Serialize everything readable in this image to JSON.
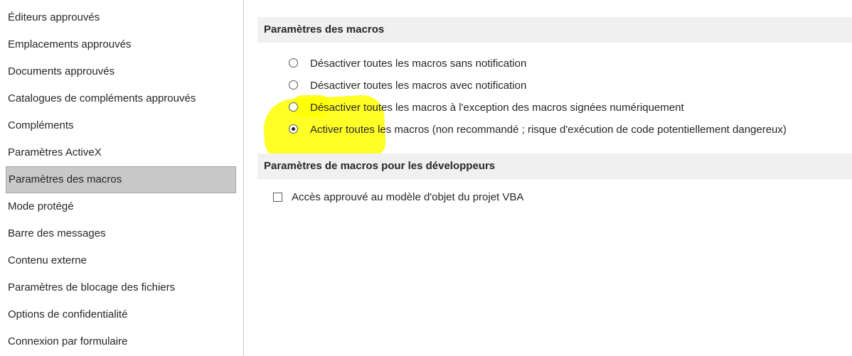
{
  "sidebar": {
    "items": [
      {
        "label": "Éditeurs approuvés"
      },
      {
        "label": "Emplacements approuvés"
      },
      {
        "label": "Documents approuvés"
      },
      {
        "label": "Catalogues de compléments approuvés"
      },
      {
        "label": "Compléments"
      },
      {
        "label": "Paramètres ActiveX"
      },
      {
        "label": "Paramètres des macros",
        "selected": true
      },
      {
        "label": "Mode protégé"
      },
      {
        "label": "Barre des messages"
      },
      {
        "label": "Contenu externe"
      },
      {
        "label": "Paramètres de blocage des fichiers"
      },
      {
        "label": "Options de confidentialité"
      },
      {
        "label": "Connexion par formulaire"
      }
    ]
  },
  "macro_settings": {
    "header": "Paramètres des macros",
    "options": [
      {
        "label": "Désactiver toutes les macros sans notification",
        "checked": false
      },
      {
        "label": "Désactiver toutes les macros avec notification",
        "checked": false
      },
      {
        "label": "Désactiver toutes les macros à l'exception des macros signées numériquement",
        "checked": false
      },
      {
        "label": "Activer toutes les macros (non recommandé ; risque d'exécution de code potentiellement dangereux)",
        "checked": true
      }
    ]
  },
  "developer_settings": {
    "header": "Paramètres de macros pour les développeurs",
    "checkbox_label": "Accès approuvé au modèle d'objet du projet VBA",
    "checked": false
  },
  "colors": {
    "selected_bg": "#c8c8c8",
    "header_bg": "#f0f0f0",
    "highlight": "#ffff00"
  }
}
